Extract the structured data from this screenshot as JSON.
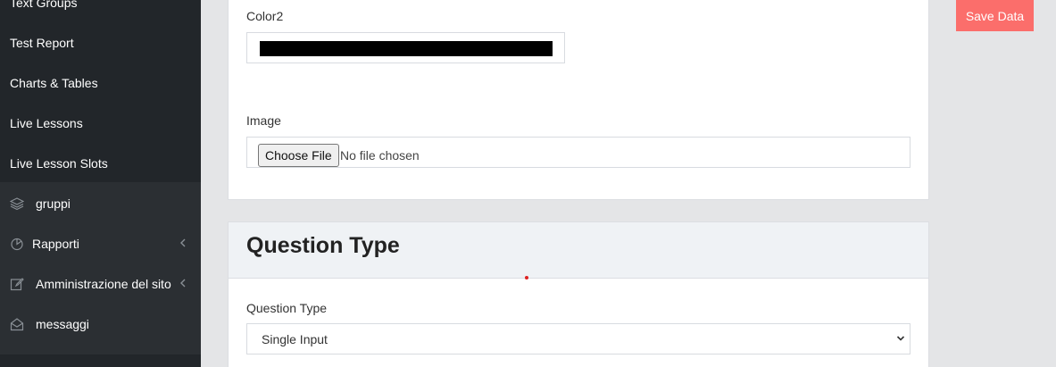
{
  "sidebar": {
    "items": [
      {
        "label": "Text Groups"
      },
      {
        "label": "Test Report"
      },
      {
        "label": "Charts & Tables"
      },
      {
        "label": "Live Lessons"
      },
      {
        "label": "Live Lesson Slots"
      },
      {
        "label": "gruppi",
        "icon": "layers-icon"
      },
      {
        "label": "Rapporti",
        "icon": "pie-chart-icon"
      },
      {
        "label": "Amministrazione del sito",
        "icon": "edit-icon"
      },
      {
        "label": "messaggi",
        "icon": "envelope-open-icon"
      }
    ]
  },
  "form": {
    "color2_label": "Color2",
    "color2_value": "#000000",
    "image_label": "Image",
    "choose_file_label": "Choose File",
    "no_file_text": "No file chosen"
  },
  "question_type_card": {
    "title": "Question Type",
    "field_label": "Question Type",
    "selected": "Single Input"
  },
  "actions": {
    "save_label": "Save Data"
  },
  "colors": {
    "sidebar_bg": "#2b2f33",
    "save_button": "#fb6e6b"
  }
}
